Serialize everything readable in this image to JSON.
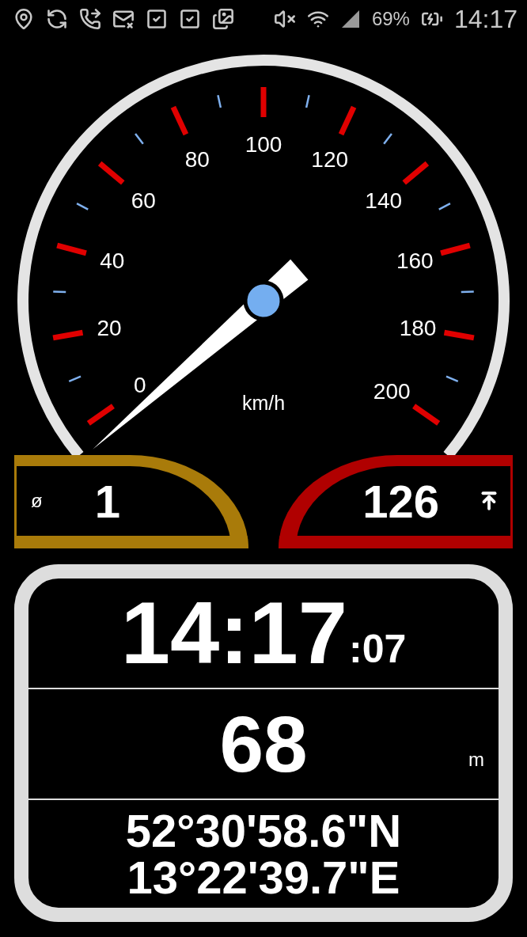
{
  "status_bar": {
    "battery": "69%",
    "time": "14:17"
  },
  "gauge": {
    "scale_labels": [
      "0",
      "20",
      "40",
      "60",
      "80",
      "100",
      "120",
      "140",
      "160",
      "180",
      "200"
    ],
    "unit": "km/h"
  },
  "average": {
    "symbol": "ø",
    "value": "1"
  },
  "maximum": {
    "value": "126"
  },
  "clock": {
    "time": "14:17",
    "seconds": ":07"
  },
  "altitude": {
    "value": "68",
    "unit": "m"
  },
  "coordinates": [
    "52°30'58.6\"N",
    "13°22'39.7\"E"
  ]
}
